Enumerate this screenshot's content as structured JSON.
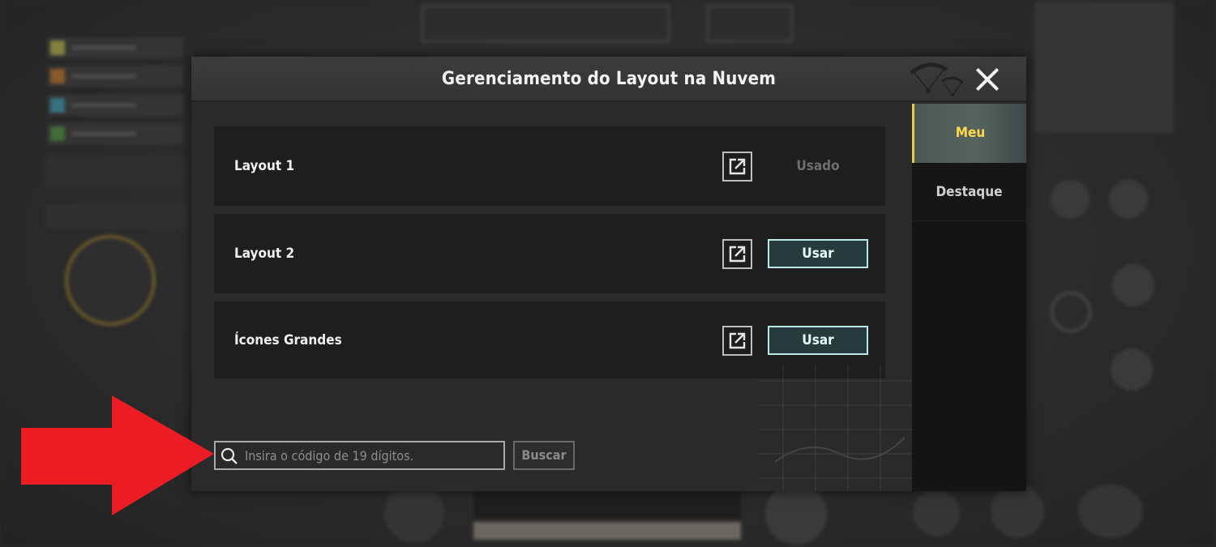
{
  "modal": {
    "title": "Gerenciamento do Layout na Nuvem"
  },
  "layouts": [
    {
      "name": "Layout 1",
      "status": "Usado",
      "in_use": true
    },
    {
      "name": "Layout 2",
      "action": "Usar",
      "in_use": false
    },
    {
      "name": "Ícones Grandes",
      "action": "Usar",
      "in_use": false
    }
  ],
  "search": {
    "placeholder": "Insira o código de 19 dígitos.",
    "value": "",
    "button_label": "Buscar"
  },
  "tabs": [
    {
      "label": "Meu",
      "active": true
    },
    {
      "label": "Destaque",
      "active": false
    }
  ],
  "icons": {
    "close": "close-icon",
    "share": "external-share-icon",
    "search": "search-icon",
    "annotation": "red-arrow-icon"
  },
  "colors": {
    "active_tab_text": "#ffd94a",
    "active_tab_marker": "#e5c84a",
    "use_button_border": "#b9e8e6",
    "use_button_bg": "#273b3e",
    "annotation_arrow": "#ec1c24"
  }
}
